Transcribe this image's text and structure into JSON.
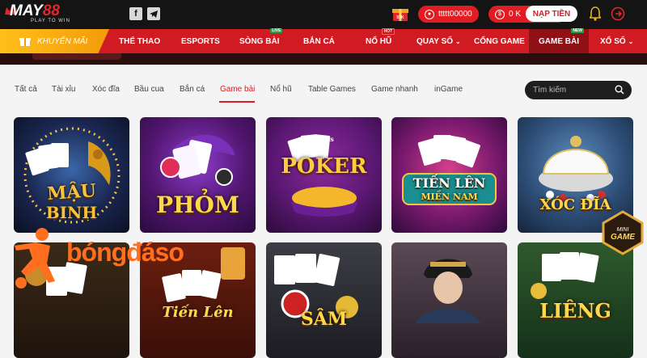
{
  "brand": {
    "logo_text_a": "MAY",
    "logo_text_b": "88",
    "tagline": "PLAY TO WIN"
  },
  "header": {
    "gift_label": "50K",
    "username": "ttttt00000",
    "balance": "0 K",
    "deposit_label": "NẠP TIỀN"
  },
  "nav": {
    "promo_label": "KHUYẾN MÃI",
    "items": [
      {
        "label": "THỂ THAO"
      },
      {
        "label": "ESPORTS"
      },
      {
        "label": "SÒNG BÀI",
        "badge": "LIVE"
      },
      {
        "label": "BẮN CÁ"
      },
      {
        "label": "NỔ HŨ",
        "badge": "HOT"
      },
      {
        "label": "QUAY SỐ"
      },
      {
        "label": "CỔNG GAME"
      },
      {
        "label": "GAME BÀI",
        "badge": "NEW"
      },
      {
        "label": "XỔ SỐ"
      }
    ]
  },
  "filters": {
    "tabs": [
      "Tất cả",
      "Tài xỉu",
      "Xóc đĩa",
      "Bầu cua",
      "Bắn cá",
      "Game bài",
      "Nổ hũ",
      "Table Games",
      "Game nhanh",
      "inGame"
    ],
    "active": "Game bài",
    "search_placeholder": "Tìm kiếm"
  },
  "games": [
    {
      "title_a": "MẬU",
      "title_b": "BINH"
    },
    {
      "title_a": "PHỎM"
    },
    {
      "title_a": "POKER",
      "subtitle": "Texas"
    },
    {
      "title_a": "TIẾN LÊN",
      "title_b": "MIỀN NAM"
    },
    {
      "title_a": "XÓC ĐĨA"
    },
    {
      "title_a": ""
    },
    {
      "title_a": "Tiến Lên"
    },
    {
      "title_a": "SÂM"
    },
    {
      "title_a": ""
    },
    {
      "title_a": "LIÊNG"
    }
  ],
  "mini_game": {
    "label_a": "MINI",
    "label_b": "GAME"
  },
  "watermark": {
    "text": "bóngđáso"
  },
  "colors": {
    "brand_red": "#d11b22",
    "active_red": "#d5202a",
    "promo_gold": "#f8a812",
    "topbar": "#141414"
  }
}
